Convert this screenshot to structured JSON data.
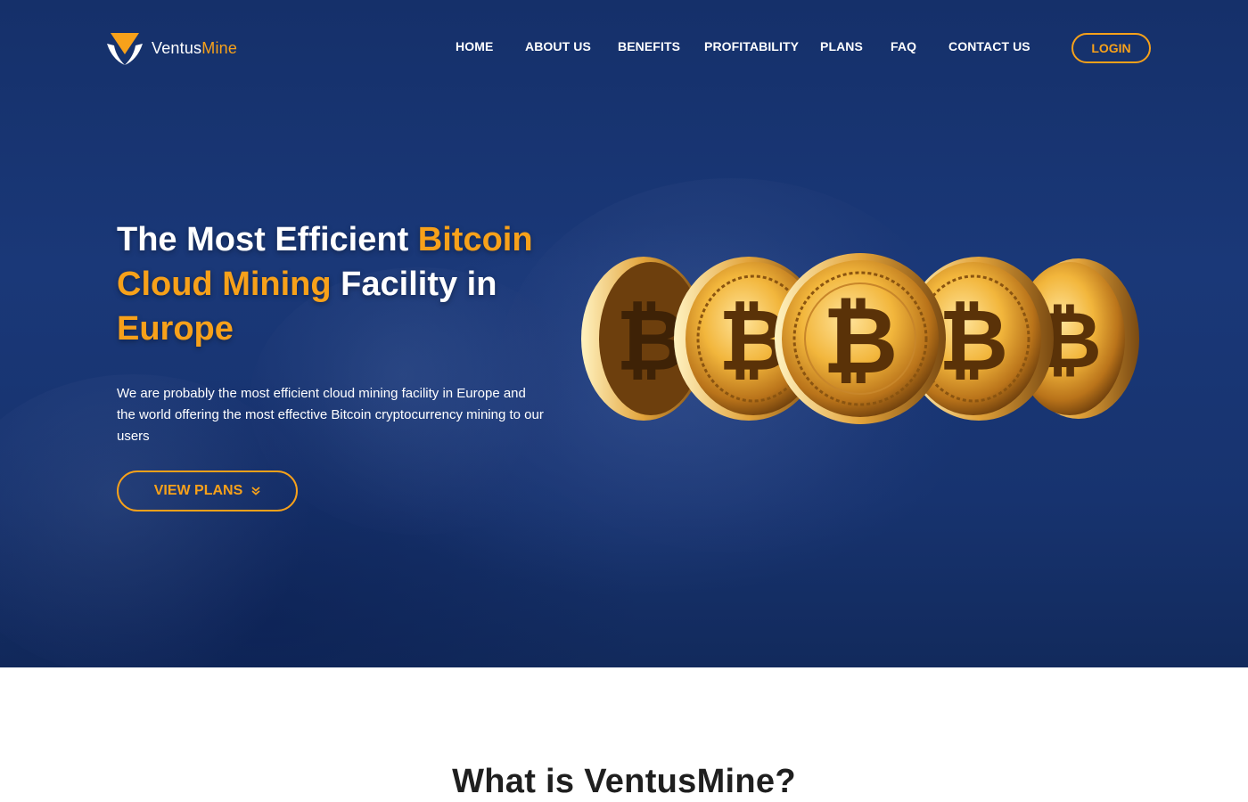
{
  "brand": {
    "name_part1": "Ventus",
    "name_part2": "Mine",
    "accent_color": "#f7a11a",
    "icon": "ventusmine-logo-icon"
  },
  "nav": {
    "items": [
      {
        "label": "HOME"
      },
      {
        "label": "ABOUT US"
      },
      {
        "label": "BENEFITS"
      },
      {
        "label": "PROFITABILITY"
      },
      {
        "label": "PLANS"
      },
      {
        "label": "FAQ"
      },
      {
        "label": "CONTACT US"
      }
    ],
    "login_label": "LOGIN"
  },
  "hero": {
    "headline": {
      "part1": "The Most Efficient ",
      "highlight1": "Bitcoin",
      "highlight2": "Cloud Mining",
      "part2": " Facility in",
      "highlight3": "Europe"
    },
    "description": "We are probably the most efficient cloud mining facility in Europe and the world offering the most effective Bitcoin cryptocurrency mining to our users",
    "cta_label": "VIEW PLANS",
    "cta_icon": "double-chevron-down-icon",
    "image": "bitcoin-coins-image",
    "background_color": "#17336f"
  },
  "section": {
    "title": "What is VentusMine?"
  }
}
